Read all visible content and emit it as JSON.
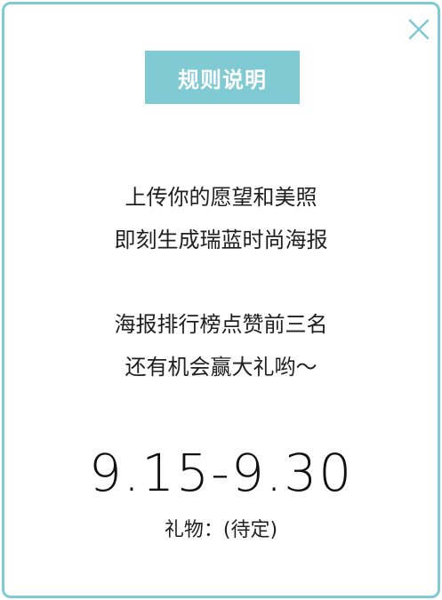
{
  "colors": {
    "accent": "#7fcad3",
    "text": "#1f1f1f",
    "background": "#ffffff"
  },
  "modal": {
    "close_icon": "close-icon",
    "title": "规则说明",
    "paragraph1": [
      "上传你的愿望和美照",
      "即刻生成瑞蓝时尚海报"
    ],
    "paragraph2": [
      "海报排行榜点赞前三名",
      "还有机会赢大礼哟～"
    ],
    "dates": "9.15-9.30",
    "gift": "礼物：(待定)"
  }
}
